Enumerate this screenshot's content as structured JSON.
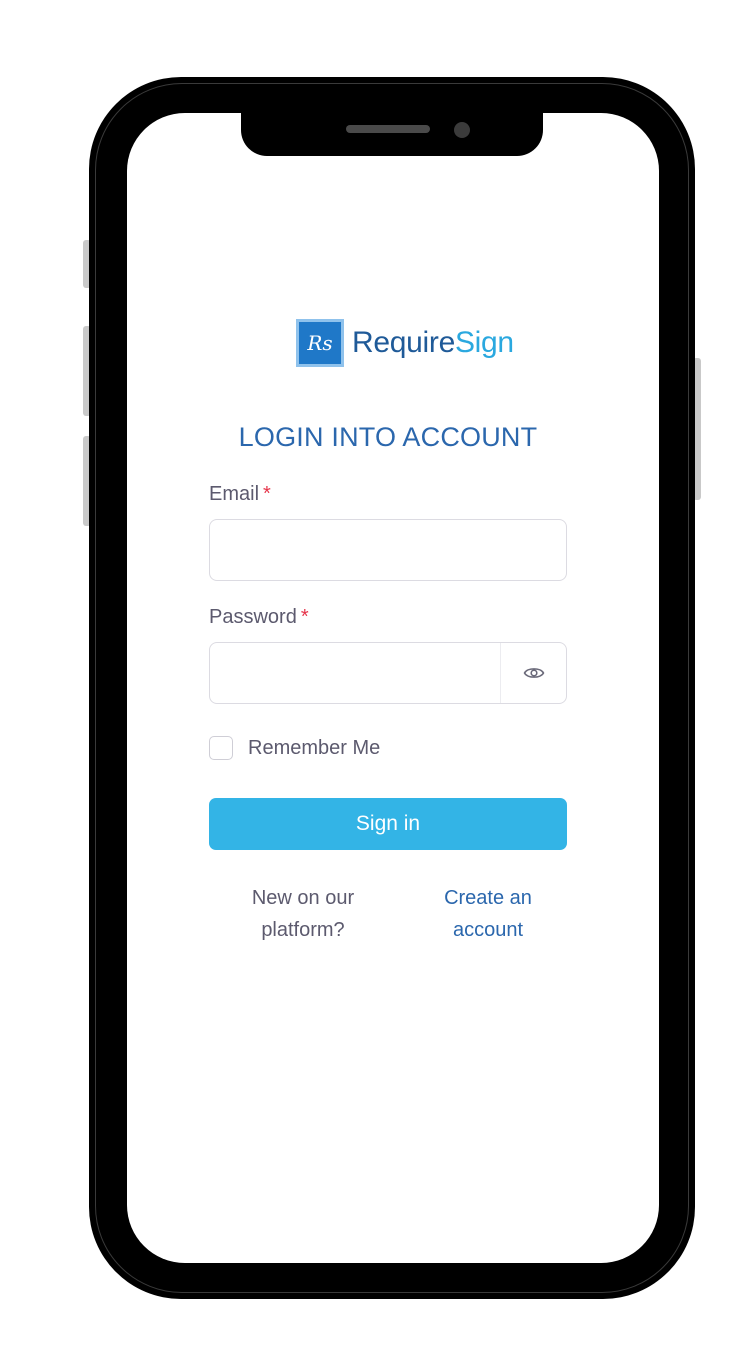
{
  "brand": {
    "logo_mark": "Rs",
    "name_part1": "Require",
    "name_part2": "Sign",
    "color_primary": "#1f5a98",
    "color_secondary": "#2aa8df"
  },
  "login": {
    "title": "LOGIN INTO ACCOUNT",
    "email_label": "Email",
    "email_required_mark": "*",
    "email_value": "",
    "email_placeholder": "",
    "password_label": "Password",
    "password_required_mark": "*",
    "password_value": "",
    "password_placeholder": "",
    "password_toggle_icon": "eye-icon",
    "remember_label": "Remember Me",
    "remember_checked": false,
    "signin_label": "Sign in",
    "signin_color": "#33b4e6",
    "footer_question_line1": "New on our",
    "footer_question_line2": "platform?",
    "create_account_line1": "Create an",
    "create_account_line2": "account"
  }
}
